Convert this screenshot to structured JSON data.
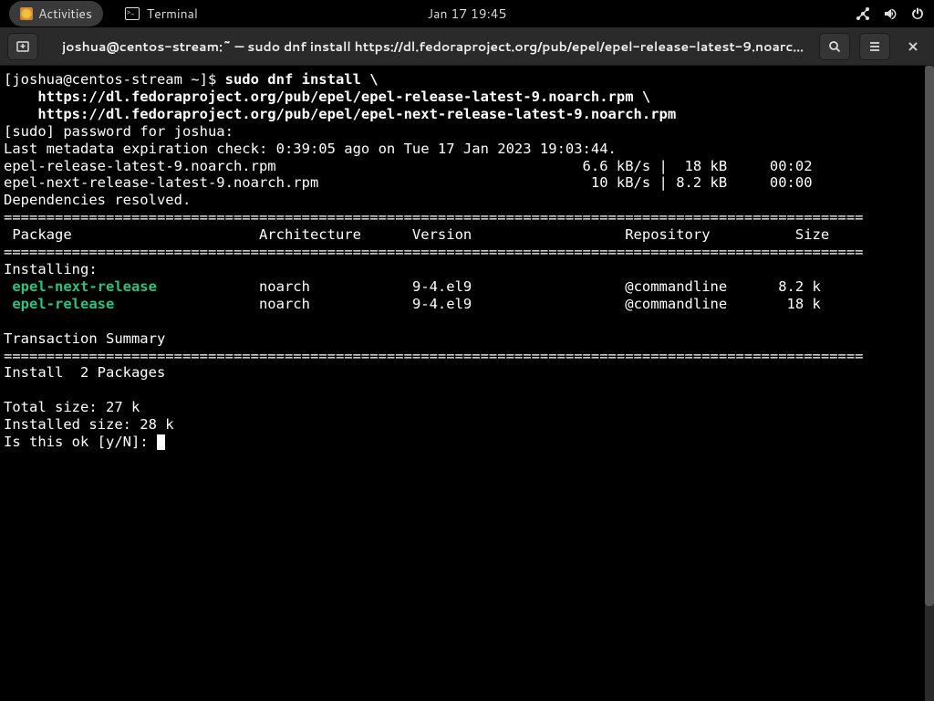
{
  "topbar": {
    "activities": "Activities",
    "app_name": "Terminal",
    "clock": "Jan 17  19:45"
  },
  "window": {
    "title": "joshua@centos-stream:~ — sudo dnf install https://dl.fedoraproject.org/pub/epel/epel-release-latest-9.noarch.rpm ..."
  },
  "term": {
    "prompt": "[joshua@centos-stream ~]$ ",
    "cmd": "sudo dnf install \\",
    "cmd_cont1": "    https://dl.fedoraproject.org/pub/epel/epel-release-latest-9.noarch.rpm \\",
    "cmd_cont2": "    https://dl.fedoraproject.org/pub/epel/epel-next-release-latest-9.noarch.rpm",
    "sudo_prompt": "[sudo] password for joshua: ",
    "metadata": "Last metadata expiration check: 0:39:05 ago on Tue 17 Jan 2023 19:03:44.",
    "dl1": "epel-release-latest-9.noarch.rpm                                    6.6 kB/s |  18 kB     00:02    ",
    "dl2": "epel-next-release-latest-9.noarch.rpm                                10 kB/s | 8.2 kB     00:00    ",
    "deps": "Dependencies resolved.",
    "hr": "=====================================================================================================",
    "header": " Package                      Architecture      Version                  Repository          Size",
    "installing": "Installing:",
    "pkg1_name": " epel-next-release",
    "pkg1_rest": "            noarch            9-4.el9                  @commandline      8.2 k",
    "pkg2_name": " epel-release",
    "pkg2_rest": "                 noarch            9-4.el9                  @commandline       18 k",
    "summary_title": "Transaction Summary",
    "install_count": "Install  2 Packages",
    "total_size": "Total size: 27 k",
    "installed_size": "Installed size: 28 k",
    "confirm": "Is this ok [y/N]: "
  }
}
